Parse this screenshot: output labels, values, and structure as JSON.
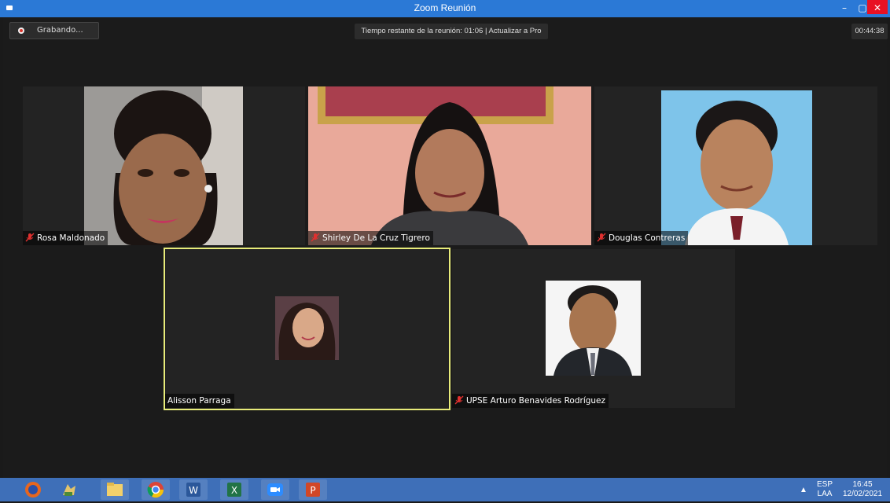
{
  "window": {
    "title": "Zoom Reunión",
    "minimize": "–",
    "maximize": "▢",
    "close": "✕"
  },
  "topbar": {
    "recording_label": "Grabando...",
    "banner": "Tiempo restante de la reunión: 01:06 | Actualizar a Pro",
    "elapsed": "00:44:38"
  },
  "participants": [
    {
      "name": "Rosa Maldonado",
      "muted": true
    },
    {
      "name": "Shirley De La Cruz Tigrero",
      "muted": true
    },
    {
      "name": "Douglas Contreras",
      "muted": true
    },
    {
      "name": "Alisson Parraga",
      "muted": false,
      "active_speaker": true
    },
    {
      "name": "UPSE Arturo Benavides Rodríguez",
      "muted": true
    }
  ],
  "colors": {
    "active_border": "#e8ec7a",
    "mute_icon": "#e0302f",
    "taskbar": "#3e6fb8",
    "titlebar": "#2b79d6"
  },
  "taskbar": {
    "apps": [
      "firefox-icon",
      "game-icon",
      "file-explorer-icon",
      "chrome-icon",
      "word-icon",
      "excel-icon",
      "zoom-icon",
      "powerpoint-icon"
    ],
    "tray_language": "ESP",
    "tray_layout": "LAA",
    "time": "16:45",
    "date": "12/02/2021"
  }
}
